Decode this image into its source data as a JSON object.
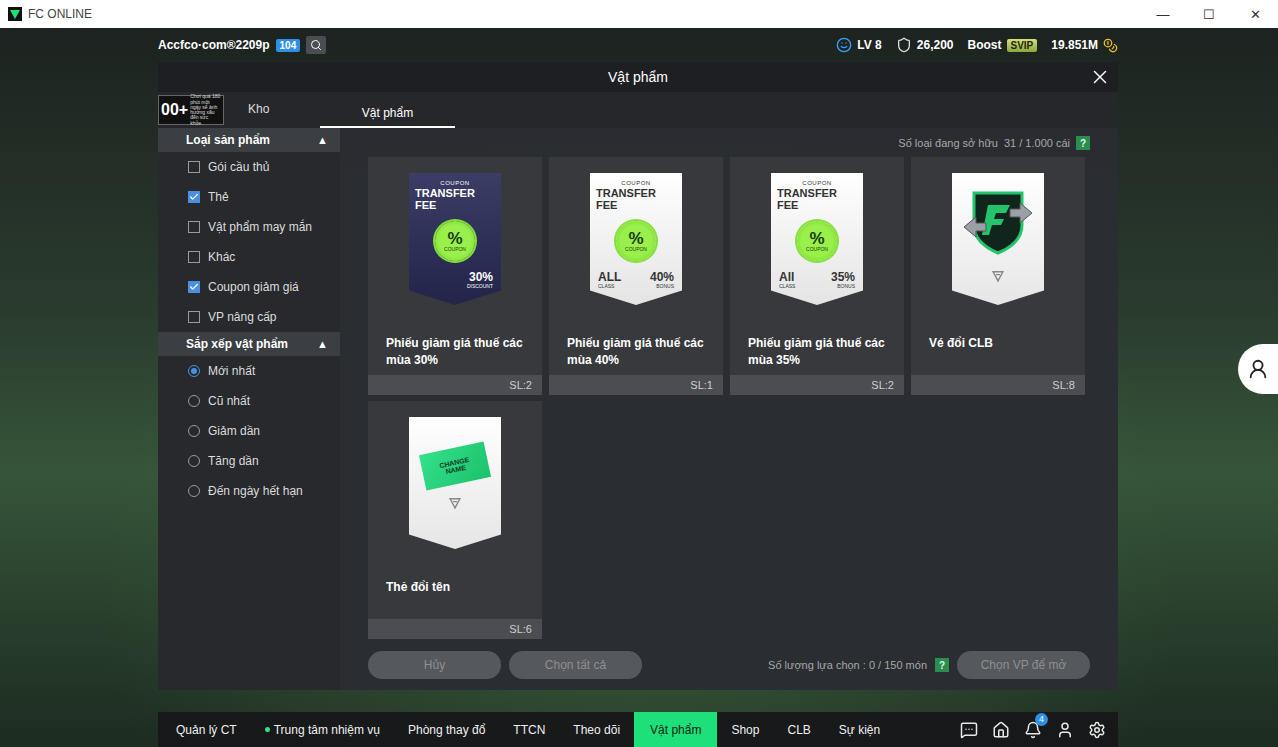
{
  "window": {
    "title": "FC ONLINE",
    "controls": [
      "—",
      "☐",
      "✕"
    ]
  },
  "header": {
    "username": "Accfco·com®2209p",
    "badge": "104",
    "level": "LV 8",
    "points": "26,200",
    "boost": "Boost",
    "vip": "SVIP",
    "coins": "19.851M"
  },
  "dialog": {
    "title": "Vật phẩm"
  },
  "age_rating": {
    "label": "00+",
    "notice": "Chơi quá 180 phút một ngày sẽ ảnh hưởng xấu đến sức khỏe."
  },
  "tabs": [
    {
      "label": "Kho",
      "selected": false
    },
    {
      "label": "Vật phẩm",
      "selected": true
    }
  ],
  "filters": {
    "title": "Loại sản phẩm",
    "toggle": "▲",
    "items": [
      {
        "label": "Gói cầu thủ",
        "checked": false
      },
      {
        "label": "Thẻ",
        "checked": true
      },
      {
        "label": "Vật phẩm may mắn",
        "checked": false
      },
      {
        "label": "Khác",
        "checked": false
      },
      {
        "label": "Coupon giảm giá",
        "checked": true
      },
      {
        "label": "VP nâng cấp",
        "checked": false
      }
    ]
  },
  "sort": {
    "title": "Sắp xếp vật phẩm",
    "toggle": "▲",
    "items": [
      {
        "label": "Mới nhất",
        "selected": true
      },
      {
        "label": "Cũ nhất",
        "selected": false
      },
      {
        "label": "Giảm dần",
        "selected": false
      },
      {
        "label": "Tăng dần",
        "selected": false
      },
      {
        "label": "Đến ngày hết hạn",
        "selected": false
      }
    ]
  },
  "owned": {
    "label": "Số loại đang sở hữu",
    "value": "31 / 1.000 cái",
    "help": "?"
  },
  "items": [
    {
      "kind": "coupon-dark",
      "name": "Phiếu giảm giá thuế các mùa 30%",
      "qty": "SL:2",
      "art": {
        "top": "COUPON",
        "title": "TRANSFER FEE",
        "badge": "%",
        "badge_label": "COUPON",
        "value": "30%",
        "sub": "DISCOUNT"
      }
    },
    {
      "kind": "coupon-light",
      "name": "Phiếu giảm giá thuế các mùa 40%",
      "qty": "SL:1",
      "art": {
        "top": "COUPON",
        "title": "TRANSFER FEE",
        "badge": "%",
        "badge_label": "COUPON",
        "value": "40%",
        "sub": "BONUS",
        "class_label": "ALL",
        "class_sub": "CLASS"
      }
    },
    {
      "kind": "coupon-light",
      "name": "Phiếu giảm giá thuế các mùa 35%",
      "qty": "SL:2",
      "art": {
        "top": "COUPON",
        "title": "TRANSFER FEE",
        "badge": "%",
        "badge_label": "COUPON",
        "value": "35%",
        "sub": "BONUS",
        "class_label": "All",
        "class_sub": "CLASS"
      }
    },
    {
      "kind": "club-ticket",
      "name": "Vé đổi CLB",
      "qty": "SL:8"
    },
    {
      "kind": "rename-card",
      "name": "Thẻ đổi tên",
      "qty": "SL:6",
      "art": {
        "ticket": "CHANGE NAME"
      }
    }
  ],
  "footer": {
    "cancel": {
      "label": "Hủy",
      "disabled": true
    },
    "select_all": {
      "label": "Chọn tất cả",
      "disabled": true
    },
    "selection": "Số lượng lựa chọn : 0 / 150 món",
    "help": "?",
    "open": {
      "label": "Chọn VP để mở",
      "disabled": true
    }
  },
  "nav": [
    {
      "label": "Quản lý CT",
      "selected": false,
      "dot": false
    },
    {
      "label": "Trung tâm nhiệm vụ",
      "selected": false,
      "dot": true
    },
    {
      "label": "Phòng thay đổ",
      "selected": false,
      "dot": false
    },
    {
      "label": "TTCN",
      "selected": false,
      "dot": false
    },
    {
      "label": "Theo dõi",
      "selected": false,
      "dot": false
    },
    {
      "label": "Vật phẩm",
      "selected": true,
      "dot": false
    },
    {
      "label": "Shop",
      "selected": false,
      "dot": false
    },
    {
      "label": "CLB",
      "selected": false,
      "dot": false
    },
    {
      "label": "Sự kiện",
      "selected": false,
      "dot": false
    }
  ],
  "notifications": "4"
}
